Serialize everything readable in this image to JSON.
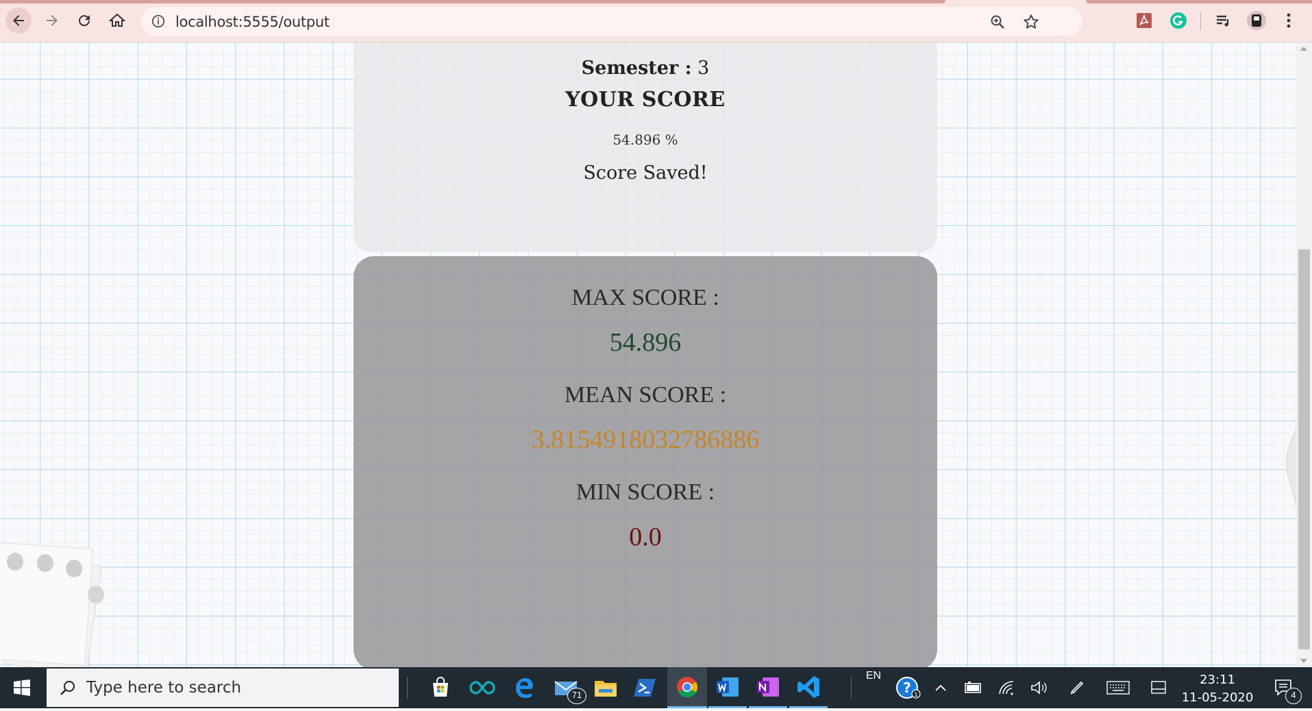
{
  "browser": {
    "url": "localhost:5555/output",
    "nav": {
      "back": "back-arrow-icon",
      "forward": "forward-arrow-icon",
      "reload": "reload-icon",
      "home": "home-icon"
    },
    "extensions": [
      "acrobat-icon",
      "grammarly-icon",
      "media-queue-icon",
      "profile-icon",
      "menu-dots-icon"
    ]
  },
  "result": {
    "semester_label": "Semester :",
    "semester_value": "3",
    "title": "YOUR SCORE",
    "percent": "54.896 %",
    "status": "Score Saved!"
  },
  "stats": {
    "max_label": "MAX SCORE :",
    "max_value": "54.896",
    "max_color": "#1e4a2a",
    "mean_label": "MEAN SCORE :",
    "mean_value": "3.8154918032786886",
    "mean_color": "#c6862a",
    "min_label": "MIN SCORE :",
    "min_value": "0.0",
    "min_color": "#6b0f0f"
  },
  "taskbar": {
    "search_placeholder": "Type here to search",
    "mail_badge": "71",
    "language": "EN",
    "time": "23:11",
    "date": "11-05-2020",
    "notifications": "4",
    "apps": [
      "store-icon",
      "arduino-icon",
      "edge-icon",
      "mail-icon",
      "file-explorer-icon",
      "powershell-icon",
      "chrome-icon",
      "word-icon",
      "onenote-icon",
      "vscode-icon"
    ]
  },
  "colors": {
    "chrome_bg": "#f8e4e2",
    "taskbar_bg": "#1f2a33"
  }
}
